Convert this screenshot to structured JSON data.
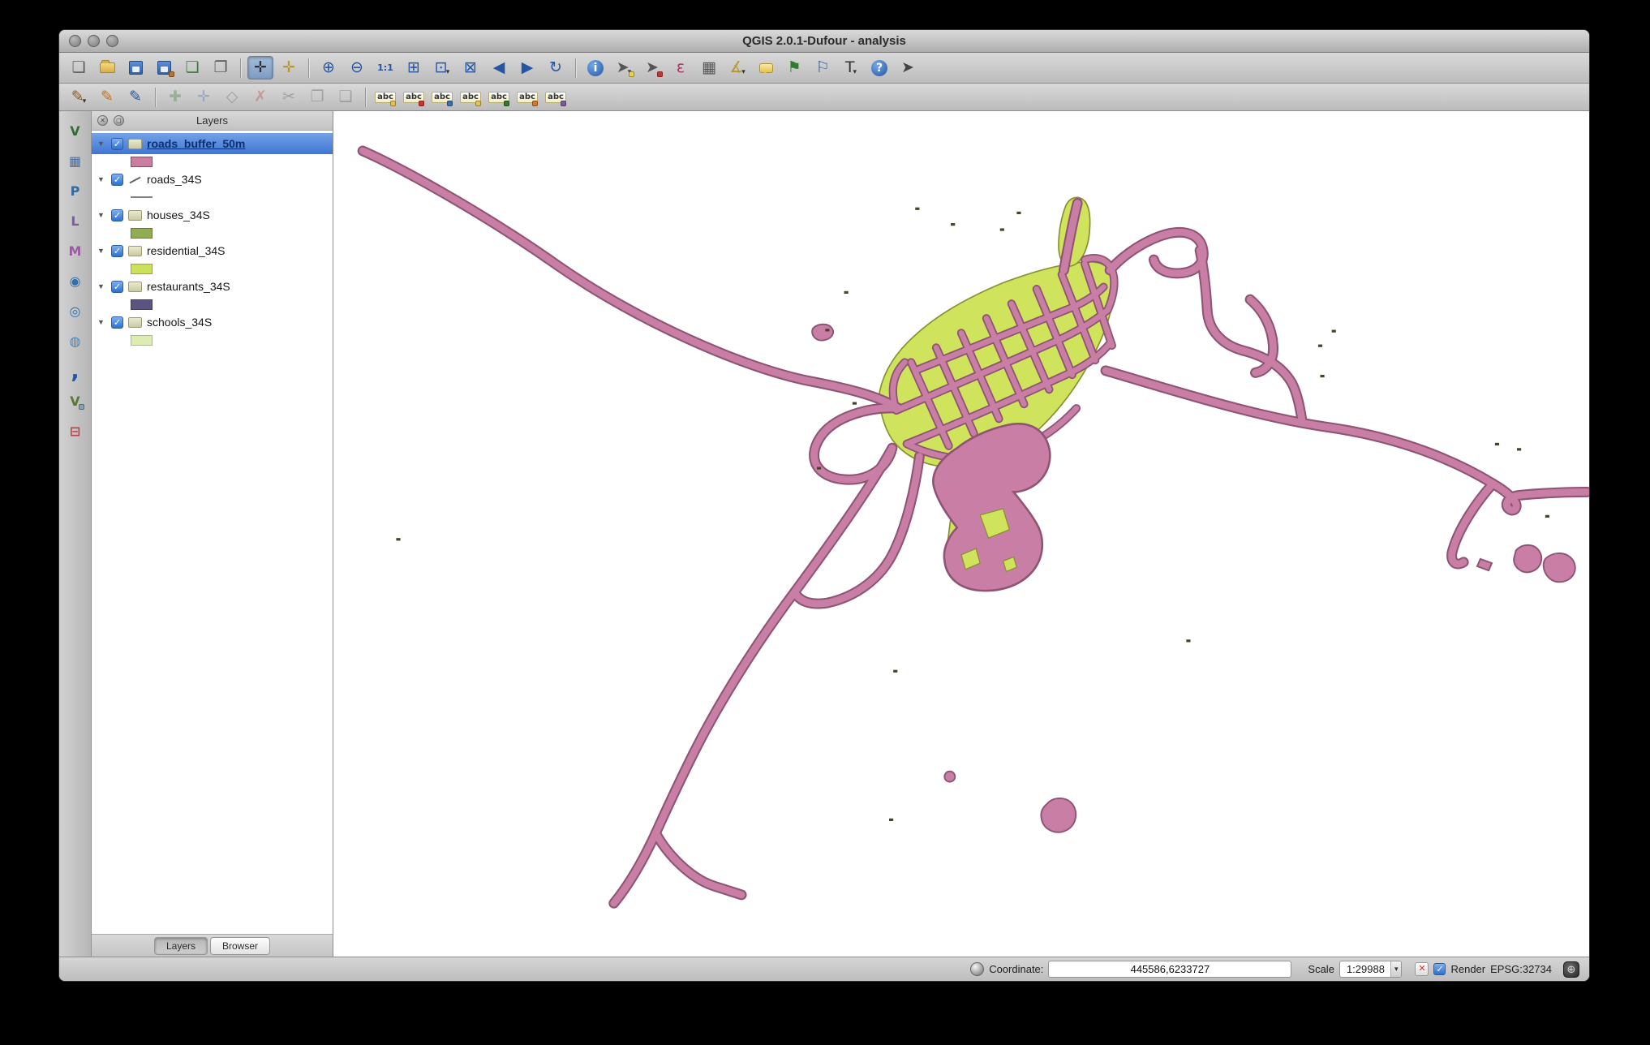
{
  "window": {
    "title": "QGIS 2.0.1-Dufour - analysis"
  },
  "toolbar_main": {
    "groups": [
      {
        "icons": [
          {
            "name": "new-project",
            "glyph": "❏",
            "color": "#5a5a5a"
          },
          {
            "name": "open-project",
            "cls": "folder"
          },
          {
            "name": "save-project",
            "cls": "floppy"
          },
          {
            "name": "save-project-as",
            "cls": "floppy",
            "accent": "#b9762a"
          },
          {
            "name": "new-print-composer",
            "glyph": "❏",
            "color": "#2e7d2e"
          },
          {
            "name": "composer-manager",
            "glyph": "❐",
            "color": "#5a5a5a"
          }
        ]
      },
      {
        "icons": [
          {
            "name": "pan-map",
            "glyph": "✛",
            "color": "#2d2d2d",
            "active": true
          },
          {
            "name": "pan-to-selection",
            "glyph": "✛",
            "color": "#b9972a"
          }
        ]
      },
      {
        "icons": [
          {
            "name": "zoom-in",
            "glyph": "⊕",
            "color": "#2456a4"
          },
          {
            "name": "zoom-out",
            "glyph": "⊖",
            "color": "#2456a4"
          },
          {
            "name": "zoom-native",
            "glyph": "1:1",
            "color": "#2456a4",
            "cls": "small"
          },
          {
            "name": "zoom-full",
            "glyph": "⊞",
            "color": "#2456a4"
          },
          {
            "name": "zoom-to-selection",
            "glyph": "⊡",
            "color": "#2456a4",
            "dropdown": true
          },
          {
            "name": "zoom-to-layer",
            "glyph": "⊠",
            "color": "#2456a4"
          },
          {
            "name": "zoom-last",
            "glyph": "◀",
            "color": "#2456a4"
          },
          {
            "name": "zoom-next",
            "glyph": "▶",
            "color": "#2456a4"
          },
          {
            "name": "map-refresh",
            "glyph": "↻",
            "color": "#2456a4"
          }
        ]
      },
      {
        "icons": [
          {
            "name": "identify-features",
            "glyph": "i",
            "cls": "round-blue"
          },
          {
            "name": "select-features",
            "glyph": "➤",
            "color": "#555555",
            "accent": "#e8d44a",
            "dropdown": true
          },
          {
            "name": "deselect-features",
            "glyph": "➤",
            "color": "#555555",
            "accent": "#cc3333"
          },
          {
            "name": "field-calculator",
            "glyph": "ε",
            "color": "#aa3366"
          },
          {
            "name": "open-attribute-table",
            "glyph": "▦",
            "color": "#555555"
          },
          {
            "name": "measure",
            "glyph": "∡",
            "color": "#b9972a",
            "dropdown": true
          },
          {
            "name": "map-tips",
            "cls": "bubble"
          },
          {
            "name": "new-bookmark",
            "glyph": "⚑",
            "color": "#2e7d2e"
          },
          {
            "name": "show-bookmarks",
            "glyph": "⚐",
            "color": "#2456a4"
          },
          {
            "name": "text-annotation",
            "glyph": "T",
            "color": "#333333",
            "dropdown": true
          },
          {
            "name": "help-contents",
            "glyph": "?",
            "cls": "round-blue"
          },
          {
            "name": "whats-this",
            "glyph": "➤",
            "color": "#444444"
          }
        ]
      }
    ]
  },
  "toolbar_edit": {
    "groups": [
      {
        "icons": [
          {
            "name": "current-edits",
            "glyph": "✎",
            "color": "#8a5a2a",
            "dropdown": true
          },
          {
            "name": "toggle-editing",
            "glyph": "✎",
            "color": "#b9762a"
          },
          {
            "name": "save-layer-edits",
            "glyph": "✎",
            "color": "#2456a4"
          }
        ]
      },
      {
        "icons": [
          {
            "name": "add-feature",
            "glyph": "✚",
            "color": "#2e7d2e",
            "disabled": true
          },
          {
            "name": "move-feature",
            "glyph": "✛",
            "color": "#2f62ae",
            "disabled": true
          },
          {
            "name": "node-tool",
            "glyph": "◇",
            "color": "#444444",
            "disabled": true
          },
          {
            "name": "delete-selected",
            "glyph": "✗",
            "color": "#b03030",
            "disabled": true
          },
          {
            "name": "cut-features",
            "glyph": "✂",
            "color": "#444444",
            "disabled": true
          },
          {
            "name": "copy-features",
            "glyph": "❐",
            "color": "#444444",
            "disabled": true
          },
          {
            "name": "paste-features",
            "glyph": "❑",
            "color": "#444444",
            "disabled": true
          }
        ]
      },
      {
        "icons": [
          {
            "name": "labeling-options",
            "glyph": "abc",
            "cls": "abc",
            "accent": "#e8c34a"
          },
          {
            "name": "pin-labels",
            "glyph": "abc",
            "cls": "abc",
            "accent": "#cc3333"
          },
          {
            "name": "highlight-pinned-labels",
            "glyph": "abc",
            "cls": "abc",
            "accent": "#3b6fae"
          },
          {
            "name": "show-hide-labels",
            "glyph": "abc",
            "cls": "abc",
            "accent": "#e8c34a"
          },
          {
            "name": "move-label",
            "glyph": "abc",
            "cls": "abc",
            "accent": "#2e7d2e"
          },
          {
            "name": "rotate-label",
            "glyph": "abc",
            "cls": "abc",
            "accent": "#d9772a"
          },
          {
            "name": "change-label",
            "glyph": "abc",
            "cls": "abc",
            "accent": "#7a5ca0"
          }
        ]
      }
    ]
  },
  "side_toolbar": {
    "icons": [
      {
        "name": "add-vector-layer",
        "glyph": "V",
        "color": "#2e6e2e"
      },
      {
        "name": "add-raster-layer",
        "glyph": "▦",
        "color": "#4a6e9e"
      },
      {
        "name": "add-postgis-layer",
        "glyph": "P",
        "color": "#336a9c"
      },
      {
        "name": "add-spatialite-layer",
        "glyph": "L",
        "color": "#7a5ca0"
      },
      {
        "name": "add-mssql-layer",
        "glyph": "M",
        "color": "#9c5ca0"
      },
      {
        "name": "add-wms-layer",
        "glyph": "◉",
        "color": "#2f6fb0"
      },
      {
        "name": "add-wcs-layer",
        "glyph": "◎",
        "color": "#2f6fb0"
      },
      {
        "name": "add-wfs-layer",
        "glyph": "◍",
        "color": "#3a86c8"
      },
      {
        "name": "add-delimited-text-layer",
        "glyph": ",",
        "color": "#2456a4",
        "cls": "comma"
      },
      {
        "name": "new-shapefile-layer",
        "glyph": "V",
        "color": "#55792f",
        "accent": "#8aa0b8"
      },
      {
        "name": "remove-layer",
        "glyph": "⊟",
        "color": "#c04040"
      }
    ]
  },
  "layers_panel": {
    "title": "Layers",
    "close_glyph": "✕",
    "float_glyph": "◻",
    "tabs": [
      {
        "label": "Layers",
        "active": true
      },
      {
        "label": "Browser",
        "active": false
      }
    ],
    "items": [
      {
        "label": "roads_buffer_50m",
        "checked": true,
        "selected": true,
        "icon": "polygon",
        "swatch": {
          "type": "fill",
          "color": "#cb7e9f",
          "border": "#7d5064"
        }
      },
      {
        "label": "roads_34S",
        "checked": true,
        "icon": "line",
        "swatch": {
          "type": "line",
          "color": "#808080"
        }
      },
      {
        "label": "houses_34S",
        "checked": true,
        "icon": "polygon",
        "swatch": {
          "type": "fill",
          "color": "#90ad52",
          "border": "#66803a"
        }
      },
      {
        "label": "residential_34S",
        "checked": true,
        "icon": "polygon",
        "swatch": {
          "type": "fill",
          "color": "#cde05c",
          "border": "#98a83f"
        }
      },
      {
        "label": "restaurants_34S",
        "checked": true,
        "icon": "polygon",
        "swatch": {
          "type": "fill",
          "color": "#5b5480",
          "border": "#413c60"
        }
      },
      {
        "label": "schools_34S",
        "checked": true,
        "icon": "polygon",
        "swatch": {
          "type": "fill",
          "color": "#dcedb2",
          "border": "#a9bf7e"
        }
      }
    ]
  },
  "map": {
    "colors": {
      "buffer_fill": "#c97fa5",
      "buffer_outline": "#8e5471",
      "residential_fill": "#cfe45c",
      "residential_outline": "#8a8f33",
      "speckle": "#45452c"
    }
  },
  "status_bar": {
    "coordinate_label": "Coordinate:",
    "coordinate_value": "445586,6233727",
    "scale_label": "Scale",
    "scale_value": "1:29988",
    "render_label": "Render",
    "render_checked": true,
    "crs_label": "EPSG:32734",
    "stop_icon_glyph": "✕",
    "crs_icon_glyph": "⊕"
  }
}
